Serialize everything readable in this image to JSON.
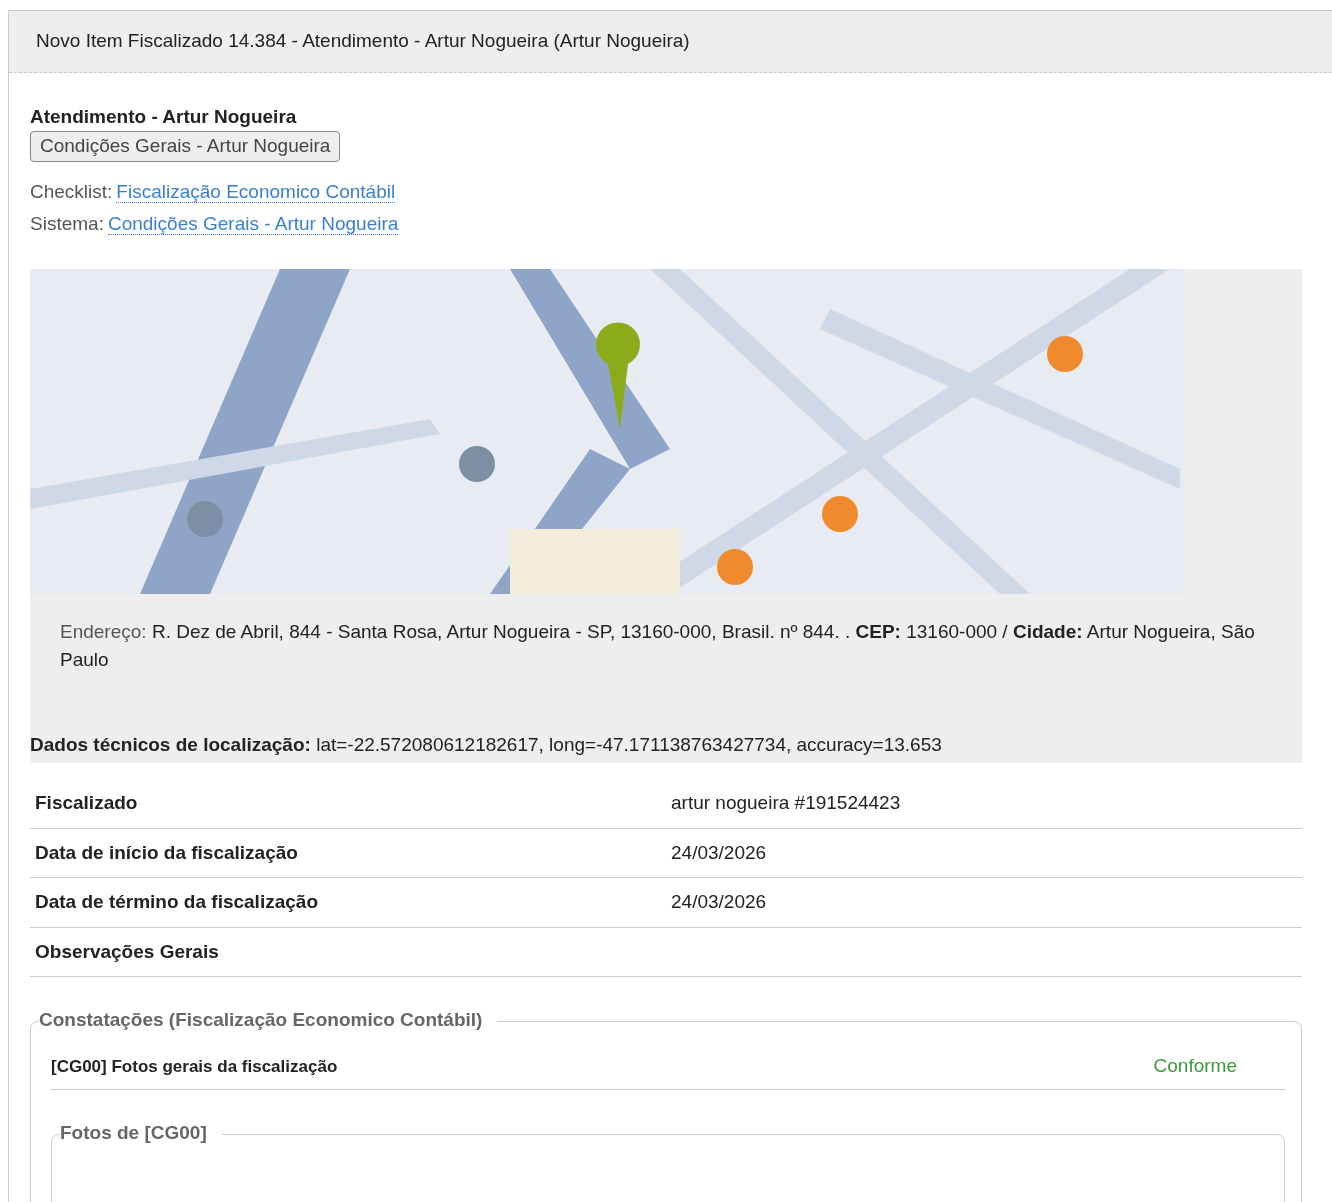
{
  "window": {
    "title": "Novo Item Fiscalizado 14.384 - Atendimento - Artur Nogueira (Artur Nogueira)"
  },
  "heading": "Atendimento - Artur Nogueira",
  "tag": "Condições Gerais - Artur Nogueira",
  "links": [
    {
      "label": "Checklist:",
      "value": "Fiscalização Economico Contábil"
    },
    {
      "label": "Sistema:",
      "value": "Condições Gerais - Artur Nogueira"
    }
  ],
  "location": {
    "address_label": "Endereço:",
    "address": "R. Dez de Abril, 844 - Santa Rosa, Artur Nogueira - SP, 13160-000, Brasil. nº 844. . **CEP:** 13160-000 / **Cidade:** Artur Nogueira, São Paulo",
    "tech_label": "Dados técnicos de localização:",
    "tech": "lat=-22.572080612182617, long=-47.171138763427734, accuracy=13.653"
  },
  "details": [
    {
      "label": "Fiscalizado",
      "value": "artur nogueira #191524423"
    },
    {
      "label": "Data de início da fiscalização",
      "value": "24/03/2026"
    },
    {
      "label": "Data de término da fiscalização",
      "value": "24/03/2026"
    },
    {
      "label": "Observações Gerais"
    }
  ],
  "findings": {
    "legend": "Constatações (Fiscalização Economico Contábil)",
    "items": [
      {
        "title": "[CG00] Fotos gerais da fiscalização",
        "status": "Conforme",
        "photos_legend": "Fotos de [CG00]"
      }
    ]
  }
}
